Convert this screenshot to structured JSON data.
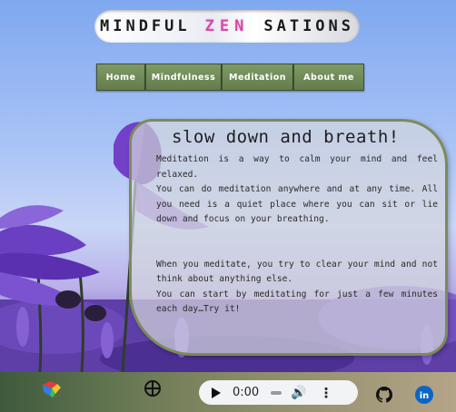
{
  "header": {
    "title_left": "MINDFUL",
    "title_accent": "ZEN",
    "title_right": "SATIONS"
  },
  "nav": {
    "items": [
      {
        "label": "Home"
      },
      {
        "label": "Mindfulness"
      },
      {
        "label": "Meditation"
      },
      {
        "label": "About me"
      }
    ]
  },
  "content": {
    "heading": "slow down and breath!",
    "paragraphs": [
      "Meditation is a way to calm your mind and feel relaxed.",
      "You can do meditation anywhere and at any time. All you need is a quiet place where you can sit or lie down and focus on your breathing.",
      "When you meditate, you try to clear your mind and not think about anything else.",
      "You can start by meditating for just a few minutes each day…Try it!"
    ]
  },
  "footer": {
    "icons": [
      "colorful-logo-icon",
      "wheel-icon",
      "github-icon",
      "linkedin-icon"
    ],
    "audio": {
      "time": "0:00"
    }
  },
  "colors": {
    "nav_green": "#6f8a57",
    "card_border": "#7d8a5b",
    "accent_pink": "#d04ca8",
    "footer_start": "#3e5a3c",
    "footer_end": "#b4a488"
  }
}
